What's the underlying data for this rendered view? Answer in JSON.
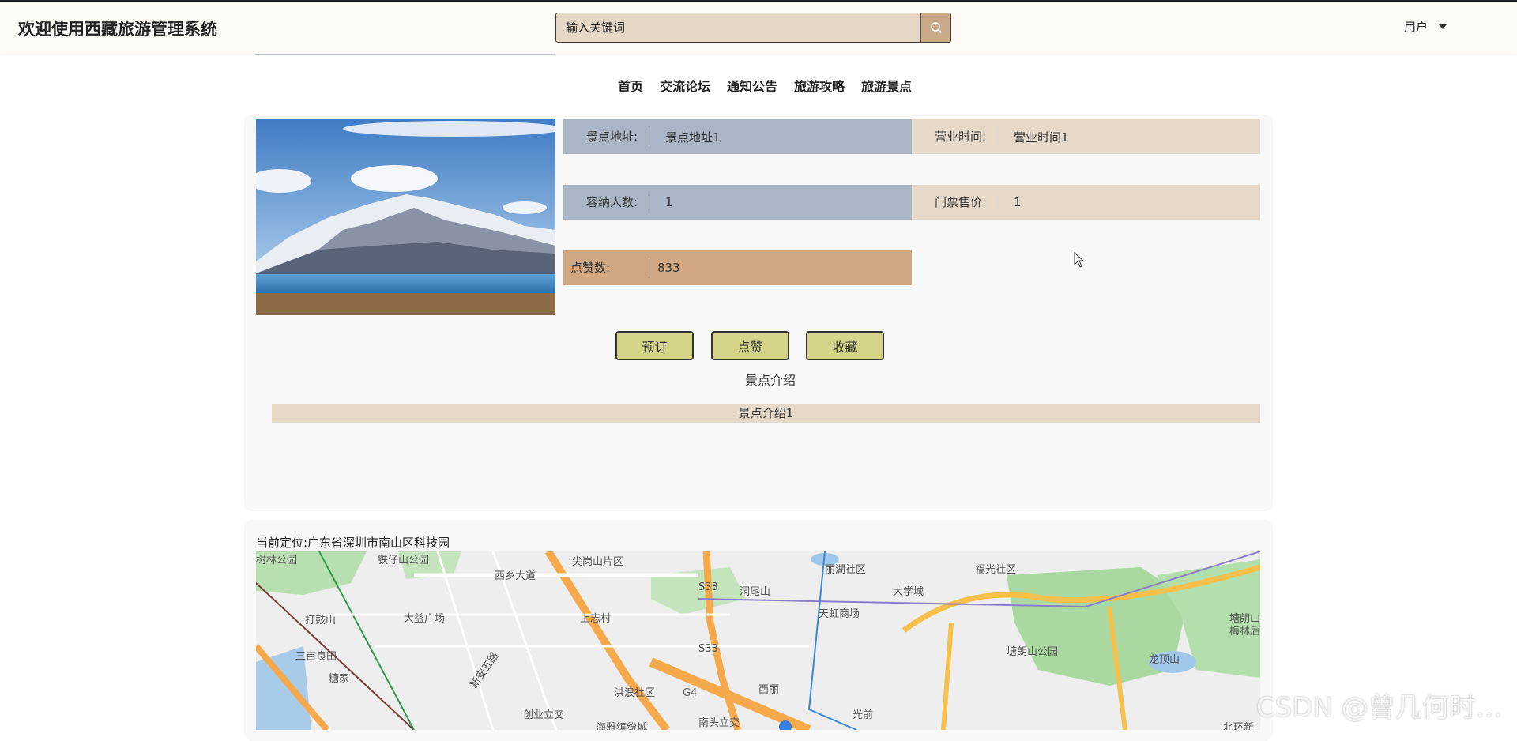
{
  "header": {
    "site_title": "欢迎使用西藏旅游管理系统",
    "search_placeholder": "输入关键词",
    "user_label": "用户"
  },
  "nav": {
    "items": [
      "首页",
      "交流论坛",
      "通知公告",
      "旅游攻略",
      "旅游景点"
    ]
  },
  "detail": {
    "fields": [
      {
        "label": "景点地址:",
        "value": "景点地址1"
      },
      {
        "label": "营业时间:",
        "value": "营业时间1"
      },
      {
        "label": "容纳人数:",
        "value": "1"
      },
      {
        "label": "门票售价:",
        "value": "1"
      },
      {
        "label": "点赞数:",
        "value": "833"
      }
    ],
    "buttons": {
      "book": "预订",
      "like": "点赞",
      "favorite": "收藏"
    },
    "intro_title": "景点介绍",
    "intro_text": "景点介绍1"
  },
  "map": {
    "location": "当前定位:广东省深圳市南山区科技园",
    "labels": [
      "树林公园",
      "铁仔山公园",
      "西乡大道",
      "尖岗山片区",
      "S33",
      "洞尾山",
      "丽湖社区",
      "福光社区",
      "大学城",
      "天虹商场",
      "打鼓山",
      "大益广场",
      "上志村",
      "塘朗山",
      "梅林后",
      "三亩良田",
      "糖家",
      "新安五路",
      "S33",
      "塘朗山公园",
      "龙顶山",
      "洪浪社区",
      "G4",
      "西丽",
      "光前",
      "创业立交",
      "海雅缤纷城",
      "南头立交",
      "北环新"
    ],
    "watermark": "CSDN @曾几何时…"
  },
  "colors": {
    "field_blue": "#aab5c6",
    "field_beige": "#e6d9c9",
    "field_tan": "#d2a882",
    "button": "#d5d58a",
    "search_bg": "#e6d8c6",
    "search_btn": "#c9a987"
  }
}
